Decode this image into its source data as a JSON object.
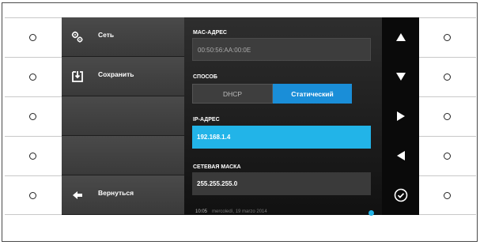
{
  "menu": {
    "items": [
      {
        "label": "Сеть",
        "icon": "gears-icon"
      },
      {
        "label": "Сохранить",
        "icon": "save-icon"
      },
      {
        "label": "",
        "icon": ""
      },
      {
        "label": "",
        "icon": ""
      },
      {
        "label": "Вернуться",
        "icon": "back-arrow-icon"
      }
    ]
  },
  "form": {
    "mac": {
      "label": "MAC-АДРЕС",
      "value": "00:50:56:AA:00:0E"
    },
    "method": {
      "label": "СПОСОБ",
      "options": [
        "DHCP",
        "Статический"
      ],
      "selected": "Статический"
    },
    "ip": {
      "label": "IP-АДРЕС",
      "value": "192.168.1.4"
    },
    "mask": {
      "label": "СЕТЕВАЯ МАСКА",
      "value": "255.255.255.0"
    }
  },
  "status": {
    "time": "10:05",
    "date": "mercoledì, 19 marzo 2014"
  },
  "colors": {
    "accent": "#22b4e8",
    "selected_segment": "#1a8ed8"
  }
}
